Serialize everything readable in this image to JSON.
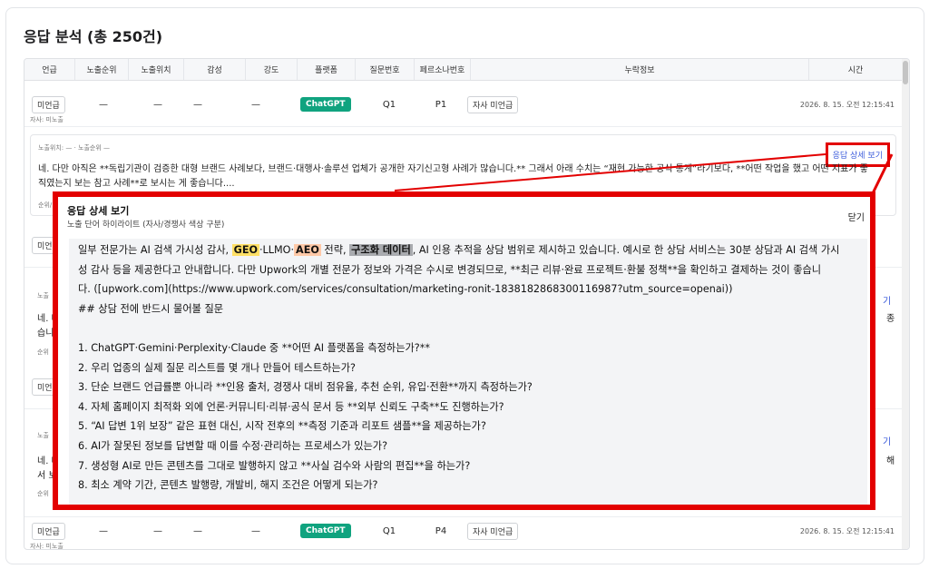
{
  "page": {
    "title": "응답 분석 (총 250건)"
  },
  "table": {
    "headers": [
      "언급",
      "노출순위",
      "노출위치",
      "감성",
      "강도",
      "플랫폼",
      "질문번호",
      "페르소나번호",
      "누락정보",
      "시간"
    ],
    "rows": [
      {
        "mention": "미언급",
        "rank": "—",
        "position": "—",
        "sentiment": "—",
        "intensity": "—",
        "platform": "ChatGPT",
        "question": "Q1",
        "persona": "P1",
        "missing": "자사 미언급",
        "time": "2026. 8. 15. 오전 12:15:41",
        "note": "자사: 미노출"
      },
      {
        "mention": "미언급",
        "rank": "—",
        "position": "—",
        "sentiment": "—",
        "intensity": "—",
        "platform": "ChatGPT",
        "question": "Q1",
        "persona": "P4",
        "missing": "자사 미언급",
        "time": "2026. 8. 15. 오전 12:15:41",
        "note": "자사: 미노출"
      }
    ],
    "partial_mentions": [
      "미언",
      "미언"
    ],
    "partial_meta": [
      "노출",
      "노출",
      "노출"
    ],
    "partial_foot": [
      "순위",
      "순위"
    ],
    "partial_left": [
      "네. 다",
      "습니",
      "네. 다",
      "서 보"
    ],
    "partial_right": [
      "기",
      "종",
      "기",
      "해"
    ]
  },
  "detail": {
    "meta": "노출위치: — · 노출순위 —",
    "text_line1": "네. 다만 아직은 **독립기관이 검증한 대형 브랜드 사례보다, 브랜드·대행사·솔루션 업체가 공개한 자기신고형 사례가 많습니다.** 그래서 아래 수치는 “재현 가능한 공식 통계”라기보다, **어떤 작업을 했고 어떤 지표가 좋",
    "text_line2": "직였는지 보는 참고 사례**로 보시는 게 좋습니다....",
    "foot": "순위/",
    "view_detail_label": "응답 상세 보기"
  },
  "modal": {
    "title": "응답 상세 보기",
    "subtitle": "노출 단어 하이라이트 (자사/경쟁사 색상 구분)",
    "close_label": "닫기",
    "line1_a": "일부 전문가는 AI 검색 가시성 감사, ",
    "hl_geo": "GEO",
    "line1_b": "·LLMO·",
    "hl_aeo": "AEO",
    "line1_c": " 전략, ",
    "hl_struct": "구조화 데이터",
    "line1_d": ", AI 인용 추적을 상담 범위로 제시하고 있습니다. 예시로 한 상담 서비스는 30분 상담과 AI 검색 가시",
    "line2": "성 감사 등을 제공한다고 안내합니다. 다만 Upwork의 개별 전문가 정보와 가격은 수시로 변경되므로, **최근 리뷰·완료 프로젝트·환불 정책**을 확인하고 결제하는 것이 좋습니",
    "line3": "다. ([upwork.com](https://www.upwork.com/services/consultation/marketing-ronit-1838182868300116987?utm_source=openai))",
    "line4": "## 상담 전에 반드시 물어볼 질문",
    "items": [
      "1. ChatGPT·Gemini·Perplexity·Claude 중 **어떤 AI 플랫폼을 측정하는가?**",
      "2. 우리 업종의 실제 질문 리스트를 몇 개나 만들어 테스트하는가?",
      "3. 단순 브랜드 언급률뿐 아니라 **인용 출처, 경쟁사 대비 점유율, 추천 순위, 유입·전환**까지 측정하는가?",
      "4. 자체 홈페이지 최적화 외에 언론·커뮤니티·리뷰·공식 문서 등 **외부 신뢰도 구축**도 진행하는가?",
      "5. “AI 답변 1위 보장” 같은 표현 대신, 시작 전후의 **측정 기준과 리포트 샘플**을 제공하는가?",
      "6. AI가 잘못된 정보를 답변할 때 이를 수정·관리하는 프로세스가 있는가?",
      "7. 생성형 AI로 만든 콘텐츠를 그대로 발행하지 않고 **사실 검수와 사람의 편집**을 하는가?",
      "8. 최소 계약 기간, 콘텐츠 발행량, 개발비, 해지 조건은 어떻게 되는가?"
    ]
  },
  "colors": {
    "accent": "#e30000",
    "platform": "#10a37f",
    "link": "#3b5bdb",
    "geo": "#ffe066",
    "aeo": "#ffc9a8",
    "struct": "#a9abaf"
  },
  "icons": {
    "scrollbar": "scrollbar-thumb"
  }
}
